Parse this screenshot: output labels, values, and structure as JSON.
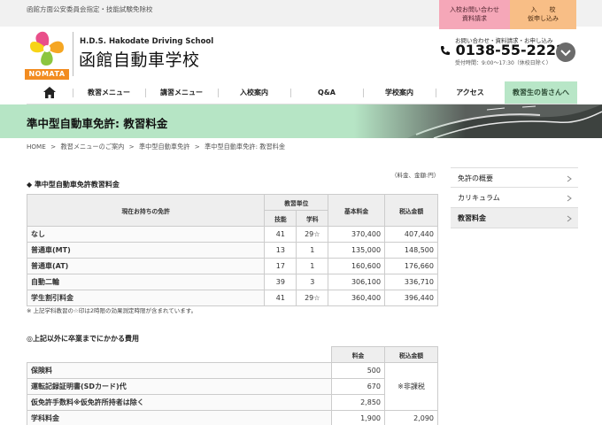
{
  "topbar": {
    "tagline": "函館方面公安委員会指定・技能試験免除校",
    "cta_left_line1": "入校お問い合わせ",
    "cta_left_line2": "資料請求",
    "cta_right_line1": "入　　校",
    "cta_right_line2": "仮申し込み"
  },
  "header": {
    "logo_word": "NOMATA",
    "school_en": "H.D.S.  Hakodate Driving School",
    "school_ja": "函館自動車学校",
    "contact_label": "お問い合わせ・資料請求・お申し込み",
    "phone": "0138-55-2222",
    "hours": "受付時間：9:00〜17:30（休校日除く）"
  },
  "nav": {
    "items": [
      "教習メニュー",
      "講習メニュー",
      "入校案内",
      "Q&A",
      "学校案内",
      "アクセス",
      "教習生の皆さんへ"
    ]
  },
  "banner": {
    "title": "準中型自動車免許: 教習料金"
  },
  "breadcrumb": [
    "HOME",
    ">",
    "教習メニューのご案内",
    ">",
    "準中型自動車免許",
    ">",
    "準中型自動車免許: 教習料金"
  ],
  "side_menu": [
    "免許の概要",
    "カリキュラム",
    "教習料金"
  ],
  "unit_note": "（料金、金額:円）",
  "section1": {
    "title": "◆ 準中型自動車免許教習料金",
    "headers": {
      "license": "現在お持ちの免許",
      "units": "教習単位",
      "skill": "技能",
      "study": "学科",
      "base": "基本料金",
      "tax": "税込金額"
    },
    "rows": [
      {
        "label": "なし",
        "skill": "41",
        "study": "29☆",
        "base": "370,400",
        "tax": "407,440"
      },
      {
        "label": "普通車(MT)",
        "skill": "13",
        "study": "1",
        "base": "135,000",
        "tax": "148,500"
      },
      {
        "label": "普通車(AT)",
        "skill": "17",
        "study": "1",
        "base": "160,600",
        "tax": "176,660"
      },
      {
        "label": "自動二輪",
        "skill": "39",
        "study": "3",
        "base": "306,100",
        "tax": "336,710"
      },
      {
        "label": "学生割引料金",
        "skill": "41",
        "study": "29☆",
        "base": "360,400",
        "tax": "396,440"
      }
    ],
    "footnote": "※ 上記学科教習の☆印は2時限の効果測定時限が含まれています。"
  },
  "section2": {
    "title": "◎上記以外に卒業までにかかる費用",
    "headers": {
      "fee": "料金",
      "tax": "税込金額"
    },
    "rows": [
      {
        "label": "保険料",
        "fee": "500",
        "tax": ""
      },
      {
        "label": "運転記録証明書(SDカード)代",
        "fee": "670",
        "tax": "※非課税"
      },
      {
        "label": "仮免許手数料※仮免許所持者は除く",
        "fee": "2,850",
        "tax": ""
      },
      {
        "label": "学科料金",
        "fee": "1,900",
        "tax": "2,090"
      }
    ]
  }
}
